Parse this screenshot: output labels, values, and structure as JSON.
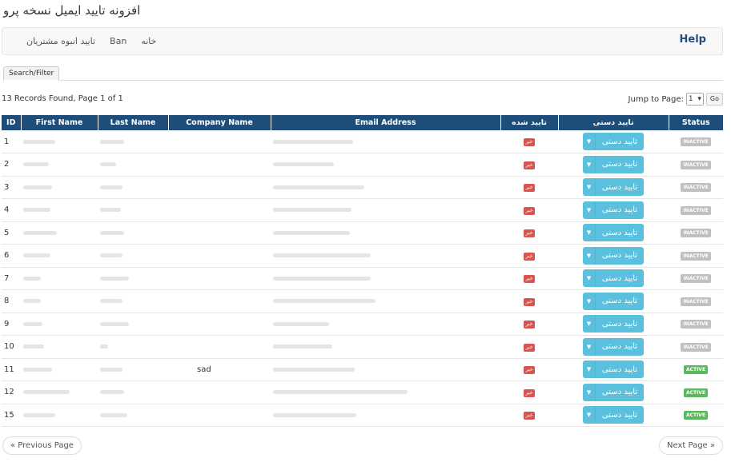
{
  "app": {
    "title": "افزونه تایید ایمیل نسخه پرو"
  },
  "nav": {
    "help": "Help",
    "links": [
      "تایید انبوه مشتریان",
      "Ban",
      "خانه"
    ]
  },
  "tabs": {
    "search_filter": "Search/Filter"
  },
  "summary": {
    "records": "13 Records Found, Page 1 of 1",
    "jump_label": "Jump to Page:",
    "jump_value": "1",
    "go_label": "Go"
  },
  "table": {
    "headers": [
      "ID",
      "First Name",
      "Last Name",
      "Company Name",
      "Email Address",
      "تایید شده",
      "تایید دستی",
      "Status"
    ],
    "rows": [
      {
        "id": "1",
        "company": "",
        "verified": "خیر",
        "action": "تایید دستی",
        "status": "INACTIVE"
      },
      {
        "id": "2",
        "company": "",
        "verified": "خیر",
        "action": "تایید دستی",
        "status": "INACTIVE"
      },
      {
        "id": "3",
        "company": "",
        "verified": "خیر",
        "action": "تایید دستی",
        "status": "INACTIVE"
      },
      {
        "id": "4",
        "company": "",
        "verified": "خیر",
        "action": "تایید دستی",
        "status": "INACTIVE"
      },
      {
        "id": "5",
        "company": "",
        "verified": "خیر",
        "action": "تایید دستی",
        "status": "INACTIVE"
      },
      {
        "id": "6",
        "company": "",
        "verified": "خیر",
        "action": "تایید دستی",
        "status": "INACTIVE"
      },
      {
        "id": "7",
        "company": "",
        "verified": "خیر",
        "action": "تایید دستی",
        "status": "INACTIVE"
      },
      {
        "id": "8",
        "company": "",
        "verified": "خیر",
        "action": "تایید دستی",
        "status": "INACTIVE"
      },
      {
        "id": "9",
        "company": "",
        "verified": "خیر",
        "action": "تایید دستی",
        "status": "INACTIVE"
      },
      {
        "id": "10",
        "company": "",
        "verified": "خیر",
        "action": "تایید دستی",
        "status": "INACTIVE"
      },
      {
        "id": "11",
        "company": "sad",
        "verified": "خیر",
        "action": "تایید دستی",
        "status": "ACTIVE"
      },
      {
        "id": "12",
        "company": "",
        "verified": "خیر",
        "action": "تایید دستی",
        "status": "ACTIVE"
      },
      {
        "id": "15",
        "company": "",
        "verified": "خیر",
        "action": "تایید دستی",
        "status": "ACTIVE"
      }
    ]
  },
  "pager": {
    "prev": "« Previous Page",
    "next": "Next Page »"
  },
  "colors": {
    "header": "#1e4d79",
    "action": "#5bc0de",
    "verified_no": "#d9534f",
    "active": "#5cb85c",
    "inactive": "#c0c0c0"
  }
}
